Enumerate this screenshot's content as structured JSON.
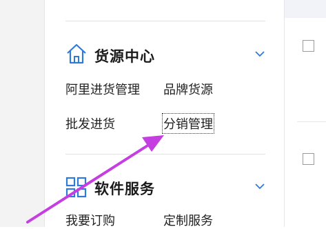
{
  "sections": {
    "source_center": {
      "title": "货源中心",
      "icon": "home-icon",
      "links": [
        "阿里进货管理",
        "品牌货源",
        "批发进货",
        "分销管理"
      ]
    },
    "software_services": {
      "title": "软件服务",
      "icon": "grid-icon",
      "links": [
        "我要订购",
        "定制服务"
      ]
    }
  },
  "colors": {
    "accent_blue": "#2f7ad9",
    "annotation_arrow": "#c43ee0"
  }
}
